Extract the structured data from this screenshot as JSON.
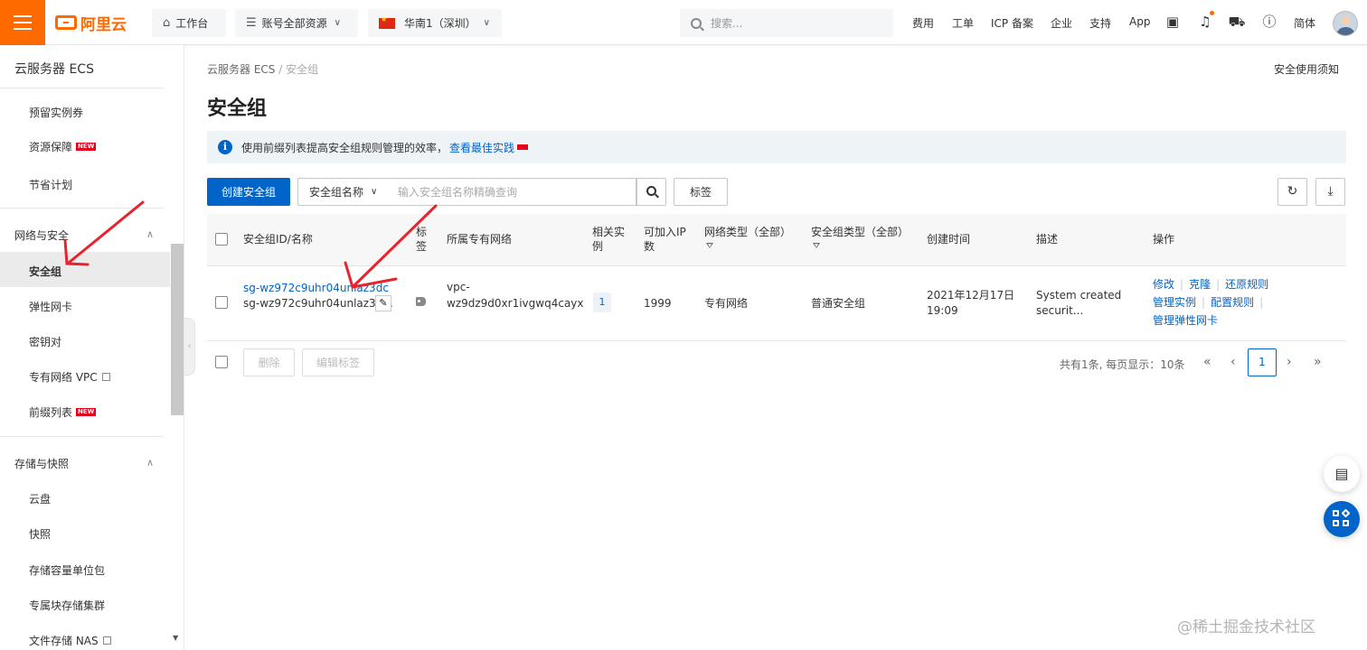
{
  "colors": {
    "brand": "#ff6a00",
    "primary": "#0064c8",
    "annotation": "#e8232b"
  },
  "topbar": {
    "logo": "阿里云",
    "workbench": "工作台",
    "resources": "账号全部资源",
    "region": "华南1（深圳）",
    "search_placeholder": "搜索...",
    "links": [
      "费用",
      "工单",
      "ICP 备案",
      "企业",
      "支持",
      "App"
    ],
    "lang": "简体",
    "icons": [
      "terminal-icon",
      "bell-icon",
      "cart-icon",
      "help-icon"
    ]
  },
  "sidebar": {
    "title": "云服务器 ECS",
    "top_items": [
      {
        "label": "预留实例券"
      },
      {
        "label": "资源保障",
        "badge": "NEW"
      },
      {
        "label": "节省计划"
      }
    ],
    "group_network": "网络与安全",
    "network_items": [
      {
        "label": "安全组"
      },
      {
        "label": "弹性网卡"
      },
      {
        "label": "密钥对"
      },
      {
        "label": "专有网络 VPC"
      },
      {
        "label": "前缀列表",
        "badge": "NEW"
      }
    ],
    "group_storage": "存储与快照",
    "storage_items": [
      {
        "label": "云盘"
      },
      {
        "label": "快照"
      },
      {
        "label": "存储容量单位包"
      },
      {
        "label": "专属块存储集群"
      },
      {
        "label": "文件存储 NAS"
      }
    ]
  },
  "main": {
    "breadcrumb": {
      "parent": "云服务器 ECS",
      "sep": "/",
      "current": "安全组"
    },
    "top_right_link": "安全使用须知",
    "title": "安全组",
    "notice": {
      "text": "使用前缀列表提高安全组规则管理的效率，",
      "link": "查看最佳实践"
    },
    "toolbar": {
      "create": "创建安全组",
      "filter_field": "安全组名称",
      "filter_placeholder": "输入安全组名称精确查询",
      "tag_button": "标签"
    },
    "table": {
      "headers": {
        "id_name": "安全组ID/名称",
        "tag": "标签",
        "vpc": "所属专有网络",
        "instances": "相关实例",
        "ip_capacity": "可加入IP数",
        "network_type": "网络类型（全部）",
        "sg_type": "安全组类型（全部）",
        "created": "创建时间",
        "description": "描述",
        "actions": "操作"
      },
      "rows": [
        {
          "id": "sg-wz972c9uhr04unlaz3dc",
          "name": "sg-wz972c9uhr04unlaz3d...",
          "vpc_line1": "vpc-",
          "vpc_line2": "wz9dz9d0xr1ivgwq4cayx",
          "instances": "1",
          "ip_capacity": "1999",
          "network_type": "专有网络",
          "sg_type": "普通安全组",
          "created_line1": "2021年12月17日",
          "created_line2": "19:09",
          "desc_line1": "System created",
          "desc_line2": "securit...",
          "actions": {
            "modify": "修改",
            "clone": "克隆",
            "restore": "还原规则",
            "manage_instances": "管理实例",
            "configure_rules": "配置规则",
            "manage_eni": "管理弹性网卡"
          }
        }
      ]
    },
    "footer": {
      "delete": "删除",
      "edit_tags": "编辑标签",
      "page_info": "共有1条, 每页显示：10条",
      "current_page": "1"
    }
  },
  "watermark": "@稀土掘金技术社区"
}
